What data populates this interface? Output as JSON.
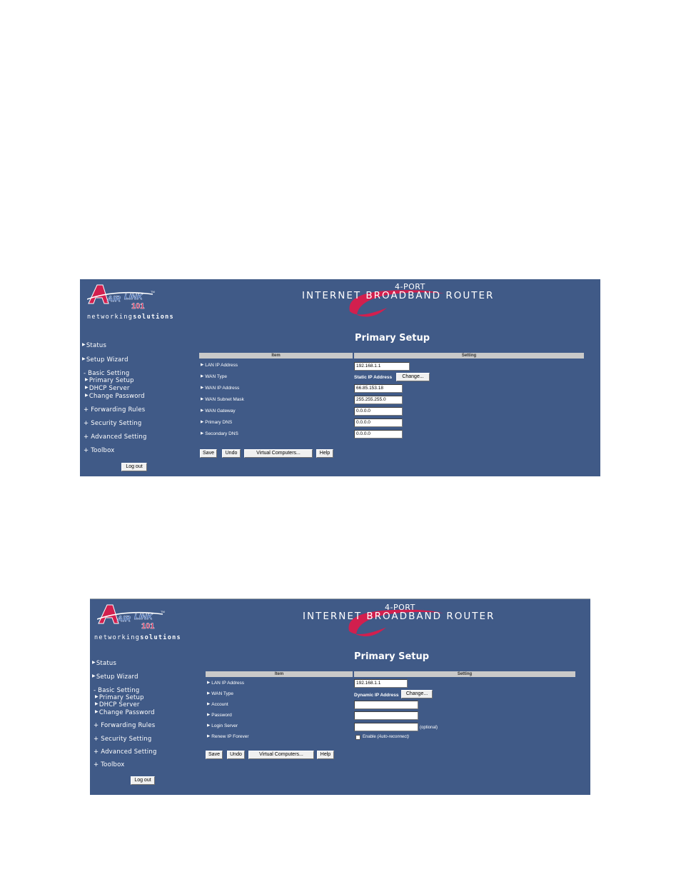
{
  "colors": {
    "panel_bg": "#405a87",
    "swoosh": "#d21f4e",
    "logo_blue": "#1e4ea3",
    "logo_red": "#d21f4e"
  },
  "brand": {
    "logo_air": "AIR",
    "logo_link": "LINK",
    "logo_tm": "TM",
    "logo_number": "101",
    "tagline_prefix": "networking",
    "tagline_suffix": "solutions",
    "banner_small": "4-PORT",
    "banner_big": "INTERNET BROADBAND ROUTER"
  },
  "screen1": {
    "nav": {
      "status": "Status",
      "setup_wizard": "Setup Wizard",
      "basic_setting": "- Basic Setting",
      "primary_setup": "Primary Setup",
      "dhcp_server": "DHCP Server",
      "change_password": "Change Password",
      "forwarding_rules": "+ Forwarding Rules",
      "security_setting": "+ Security Setting",
      "advanced_setting": "+ Advanced Setting",
      "toolbox": "+ Toolbox",
      "logout": "Log out"
    },
    "title": "Primary Setup",
    "table_headers": {
      "item": "Item",
      "setting": "Setting"
    },
    "rows": {
      "lan_ip": {
        "label": "LAN IP Address",
        "value": "192.168.1.1"
      },
      "wan_type": {
        "label": "WAN Type",
        "value": "Static IP Address",
        "button": "Change..."
      },
      "wan_ip": {
        "label": "WAN IP Address",
        "value": "66.85.153.18"
      },
      "wan_mask": {
        "label": "WAN Subnet Mask",
        "value": "255.255.255.0"
      },
      "wan_gateway": {
        "label": "WAN Gateway",
        "value": "0.0.0.0"
      },
      "primary_dns": {
        "label": "Primary DNS",
        "value": "0.0.0.0"
      },
      "secondary_dns": {
        "label": "Secondary DNS",
        "value": "0.0.0.0"
      }
    },
    "buttons": {
      "save": "Save",
      "undo": "Undo",
      "virtual": "Virtual Computers...",
      "help": "Help"
    }
  },
  "screen2": {
    "nav": {
      "status": "Status",
      "setup_wizard": "Setup Wizard",
      "basic_setting": "- Basic Setting",
      "primary_setup": "Primary Setup",
      "dhcp_server": "DHCP Server",
      "change_password": "Change Password",
      "forwarding_rules": "+ Forwarding Rules",
      "security_setting": "+ Security Setting",
      "advanced_setting": "+ Advanced Setting",
      "toolbox": "+ Toolbox",
      "logout": "Log out"
    },
    "title": "Primary Setup",
    "table_headers": {
      "item": "Item",
      "setting": "Setting"
    },
    "rows": {
      "lan_ip": {
        "label": "LAN IP Address",
        "value": "192.168.1.1"
      },
      "wan_type": {
        "label": "WAN Type",
        "value": "Dynamic IP Address",
        "button": "Change..."
      },
      "account": {
        "label": "Account",
        "value": ""
      },
      "password": {
        "label": "Password",
        "value": ""
      },
      "login_server": {
        "label": "Login Server",
        "value": "",
        "note": "(optional)"
      },
      "renew": {
        "label": "Renew IP Forever",
        "checkbox_label": "Enable",
        "checkbox_note": "(Auto-reconnect)",
        "checked": false
      }
    },
    "buttons": {
      "save": "Save",
      "undo": "Undo",
      "virtual": "Virtual Computers...",
      "help": "Help"
    }
  }
}
